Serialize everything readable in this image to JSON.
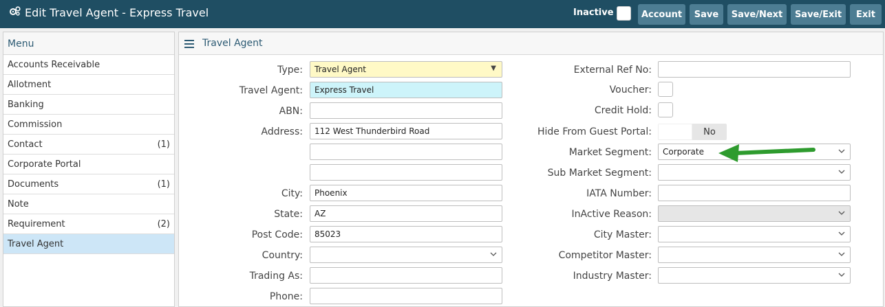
{
  "header": {
    "title": "Edit Travel Agent - Express Travel",
    "icon": "gears-icon",
    "inactive_label": "Inactive",
    "buttons": {
      "account": "Account",
      "save": "Save",
      "save_next": "Save/Next",
      "save_exit": "Save/Exit",
      "exit": "Exit"
    }
  },
  "menu": {
    "title": "Menu",
    "items": [
      {
        "label": "Accounts Receivable",
        "count": ""
      },
      {
        "label": "Allotment",
        "count": ""
      },
      {
        "label": "Banking",
        "count": ""
      },
      {
        "label": "Commission",
        "count": ""
      },
      {
        "label": "Contact",
        "count": "(1)"
      },
      {
        "label": "Corporate Portal",
        "count": ""
      },
      {
        "label": "Documents",
        "count": "(1)"
      },
      {
        "label": "Note",
        "count": ""
      },
      {
        "label": "Requirement",
        "count": "(2)"
      },
      {
        "label": "Travel Agent",
        "count": ""
      }
    ]
  },
  "panel": {
    "title": "Travel Agent",
    "left": {
      "type_label": "Type:",
      "type_value": "Travel Agent",
      "agent_label": "Travel Agent:",
      "agent_value": "Express Travel",
      "abn_label": "ABN:",
      "abn_value": "",
      "address_label": "Address:",
      "address1": "112 West Thunderbird Road",
      "address2": "",
      "address3": "",
      "city_label": "City:",
      "city_value": "Phoenix",
      "state_label": "State:",
      "state_value": "AZ",
      "post_label": "Post Code:",
      "post_value": "85023",
      "country_label": "Country:",
      "country_value": "",
      "trading_label": "Trading As:",
      "trading_value": "",
      "phone_label": "Phone:",
      "phone_value": ""
    },
    "right": {
      "extref_label": "External Ref No:",
      "extref_value": "",
      "voucher_label": "Voucher:",
      "credit_label": "Credit Hold:",
      "hide_label": "Hide From Guest Portal:",
      "hide_value": "No",
      "market_label": "Market Segment:",
      "market_value": "Corporate",
      "submarket_label": "Sub Market Segment:",
      "submarket_value": "",
      "iata_label": "IATA Number:",
      "iata_value": "",
      "inactive_reason_label": "InActive Reason:",
      "inactive_reason_value": "",
      "city_master_label": "City Master:",
      "city_master_value": "",
      "competitor_label": "Competitor Master:",
      "competitor_value": "",
      "industry_label": "Industry Master:",
      "industry_value": ""
    }
  },
  "colors": {
    "header_bg": "#1f4e63",
    "button_bg": "#4d7d93",
    "menu_active": "#cde6f7",
    "type_field_bg": "#fff9c6",
    "agent_field_bg": "#cdf4fa",
    "arrow": "#2e9b2e"
  },
  "icons": [
    "gears-icon",
    "hamburger-icon",
    "chevron-down-icon",
    "caret-down-icon",
    "green-arrow-icon"
  ]
}
